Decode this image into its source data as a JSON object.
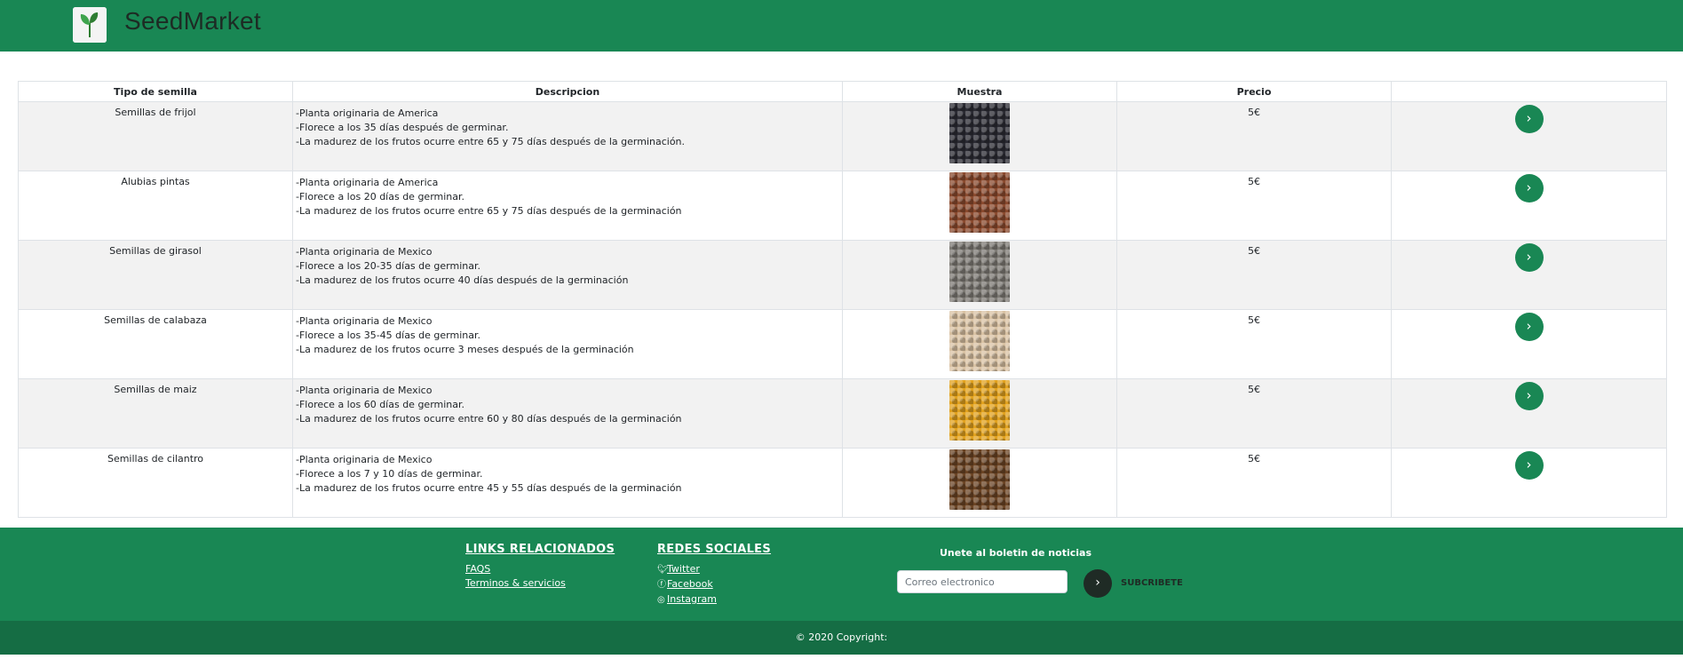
{
  "header": {
    "brand": "SeedMarket",
    "logo_icon": "seedling-logo-icon",
    "bar_color": "#198754"
  },
  "table": {
    "columns": [
      "Tipo de semilla",
      "Descripcion",
      "Muestra",
      "Precio",
      ""
    ],
    "rows": [
      {
        "name": "Semillas de frijol",
        "desc": [
          "-Planta originaria de America",
          "-Florece a los 35 días después de germinar.",
          "-La madurez de los frutos ocurre entre 65 y 75 días después de la germinación."
        ],
        "price": "5€",
        "sample_color": "#2b2b33"
      },
      {
        "name": "Alubias pintas",
        "desc": [
          "-Planta originaria de America",
          "-Florece a los 20 días de germinar.",
          "-La madurez de los frutos ocurre entre 65 y 75 días después de la germinación"
        ],
        "price": "5€",
        "sample_color": "#8a4a2e"
      },
      {
        "name": "Semillas de girasol",
        "desc": [
          "-Planta originaria de Mexico",
          "-Florece a los 20-35 días de germinar.",
          "-La madurez de los frutos ocurre 40 días después de la germinación"
        ],
        "price": "5€",
        "sample_color": "#7d7a74"
      },
      {
        "name": "Semillas de calabaza",
        "desc": [
          "-Planta originaria de Mexico",
          "-Florece a los 35-45 días de germinar.",
          "-La madurez de los frutos ocurre 3 meses después de la germinación"
        ],
        "price": "5€",
        "sample_color": "#d9c2a3"
      },
      {
        "name": "Semillas de maiz",
        "desc": [
          "-Planta originaria de Mexico",
          "-Florece a los 60 días de germinar.",
          "-La madurez de los frutos ocurre entre 60 y 80 días después de la germinación"
        ],
        "price": "5€",
        "sample_color": "#e2a21e"
      },
      {
        "name": "Semillas de cilantro",
        "desc": [
          "-Planta originaria de Mexico",
          "-Florece a los 7 y 10 días de germinar.",
          "-La madurez de los frutos ocurre entre 45 y 55 días después de la germinación"
        ],
        "price": "5€",
        "sample_color": "#6b4424"
      }
    ],
    "action_icon": "chevron-right-icon",
    "stripe_color": "#f2f2f2"
  },
  "footer": {
    "links_title": "LINKS RELACIONADOS",
    "links": [
      "FAQS",
      "Terminos & servicios"
    ],
    "social_title": "REDES SOCIALES",
    "social": [
      {
        "label": "Twitter",
        "icon": "twitter-icon"
      },
      {
        "label": "Facebook",
        "icon": "facebook-icon"
      },
      {
        "label": "Instagram",
        "icon": "instagram-icon"
      }
    ],
    "newsletter_title": "Unete al boletin de noticias",
    "newsletter_placeholder": "Correo electronico",
    "subscribe_label": "SUBCRIBETE",
    "copyright": "© 2020 Copyright:"
  }
}
